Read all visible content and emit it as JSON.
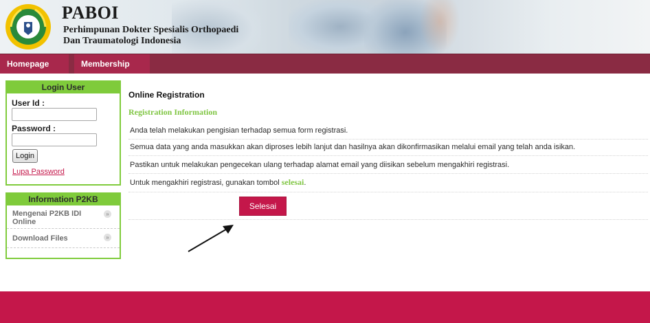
{
  "header": {
    "title": "PABOI",
    "subtitle_line1": "Perhimpunan Dokter Spesialis Orthopaedi",
    "subtitle_line2": "Dan Traumatologi Indonesia"
  },
  "nav": {
    "items": [
      {
        "label": "Homepage"
      },
      {
        "label": "Membership"
      }
    ]
  },
  "login_box": {
    "title": "Login User",
    "user_id_label": "User Id :",
    "user_id_value": "",
    "password_label": "Password :",
    "password_value": "",
    "login_button": "Login",
    "forgot_link": "Lupa Password"
  },
  "info_box": {
    "title": "Information P2KB",
    "items": [
      {
        "label_line1": "Mengenai P2KB IDI",
        "label_line2": "Online"
      },
      {
        "label_line1": "Download Files"
      }
    ]
  },
  "main": {
    "title": "Online Registration",
    "section_title": "Registration Information",
    "lines": [
      "Anda telah melakukan pengisian terhadap semua form registrasi.",
      "Semua data yang anda masukkan akan diproses lebih lanjut dan hasilnya akan dikonfirmasikan melalui email yang telah anda isikan.",
      "Pastikan untuk melakukan pengecekan ulang terhadap alamat email yang diisikan sebelum mengakhiri registrasi."
    ],
    "last_line_prefix": "Untuk mengakhiri registrasi, gunakan tombol ",
    "last_line_highlight": "selesai",
    "last_line_suffix": ".",
    "finish_button": "Selesai"
  },
  "colors": {
    "nav_bg": "#8a2b43",
    "accent": "#c4174a",
    "green": "#7fcb3b"
  }
}
